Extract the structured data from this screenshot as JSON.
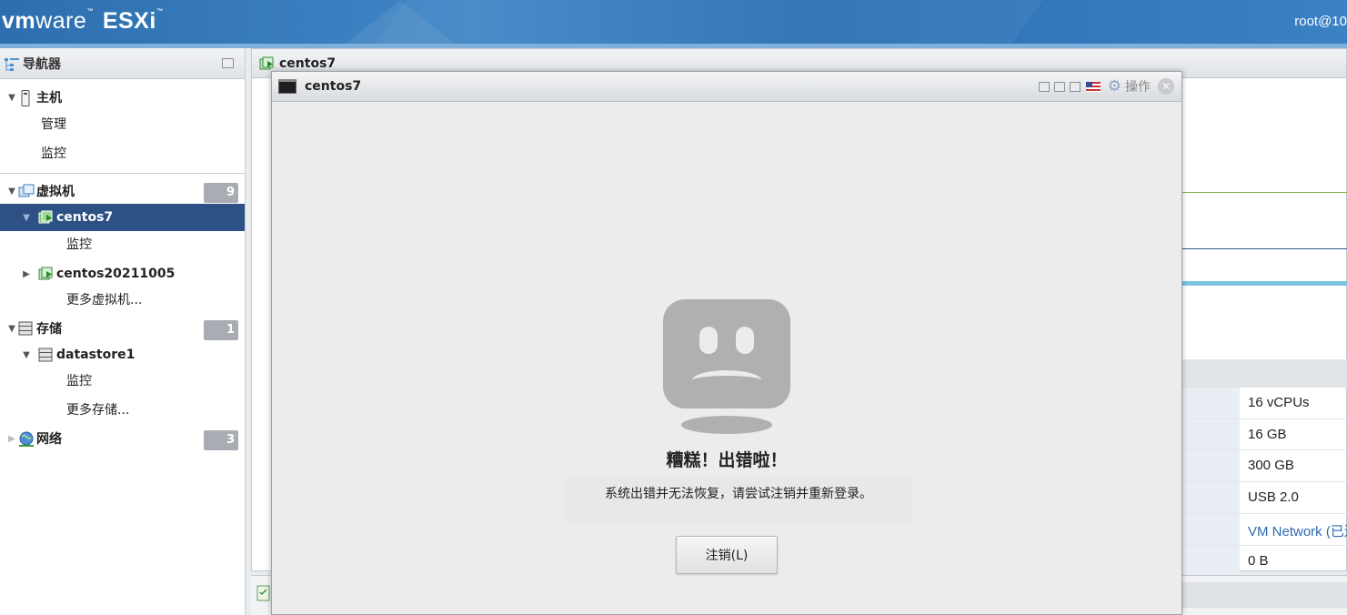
{
  "header": {
    "logo_vm": "vm",
    "logo_ware": "ware",
    "logo_product": "ESXi",
    "user": "root@10"
  },
  "navigator": {
    "title": "导航器",
    "host": {
      "label": "主机",
      "children": [
        "管理",
        "监控"
      ]
    },
    "vms": {
      "label": "虚拟机",
      "count": "9",
      "items": [
        {
          "label": "centos7",
          "children": [
            "监控"
          ]
        },
        {
          "label": "centos20211005"
        }
      ],
      "more": "更多虚拟机..."
    },
    "storage": {
      "label": "存储",
      "count": "1",
      "items": [
        {
          "label": "datastore1",
          "children": [
            "监控"
          ]
        }
      ],
      "more": "更多存储..."
    },
    "network": {
      "label": "网络",
      "count": "3"
    }
  },
  "main": {
    "title": "centos7"
  },
  "specs": [
    {
      "value": "16 vCPUs"
    },
    {
      "value": "16 GB"
    },
    {
      "value": "300 GB"
    },
    {
      "value": "USB 2.0"
    },
    {
      "value": "VM Network (已连"
    },
    {
      "value": "0 B"
    }
  ],
  "console": {
    "title": "centos7",
    "actions_label": "操作",
    "error_title": "糟糕！出错啦！",
    "error_message": "系统出错并无法恢复，请尝试注销并重新登录。",
    "logout_button": "注销(L)"
  }
}
